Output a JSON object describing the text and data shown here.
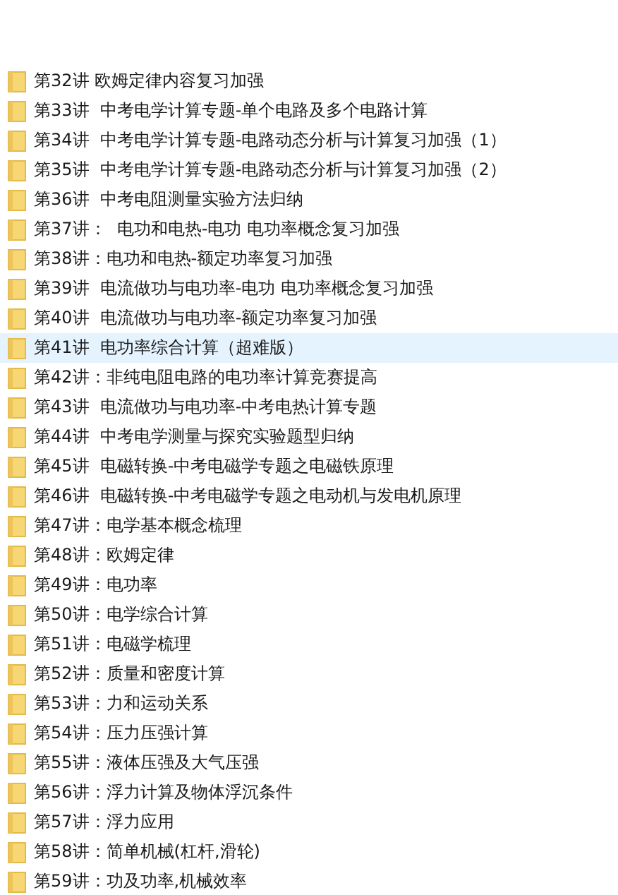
{
  "items": [
    {
      "name": "第32讲 欧姆定律内容复习加强",
      "selected": false
    },
    {
      "name": "第33讲  中考电学计算专题-单个电路及多个电路计算",
      "selected": false
    },
    {
      "name": "第34讲  中考电学计算专题-电路动态分析与计算复习加强（1）",
      "selected": false
    },
    {
      "name": "第35讲  中考电学计算专题-电路动态分析与计算复习加强（2）",
      "selected": false
    },
    {
      "name": "第36讲  中考电阻测量实验方法归纳",
      "selected": false
    },
    {
      "name": "第37讲：  电功和电热-电功 电功率概念复习加强",
      "selected": false
    },
    {
      "name": "第38讲：电功和电热-额定功率复习加强",
      "selected": false
    },
    {
      "name": "第39讲  电流做功与电功率-电功 电功率概念复习加强",
      "selected": false
    },
    {
      "name": "第40讲  电流做功与电功率-额定功率复习加强",
      "selected": false
    },
    {
      "name": "第41讲  电功率综合计算（超难版）",
      "selected": true
    },
    {
      "name": "第42讲：非纯电阻电路的电功率计算竞赛提高",
      "selected": false
    },
    {
      "name": "第43讲  电流做功与电功率-中考电热计算专题",
      "selected": false
    },
    {
      "name": "第44讲  中考电学测量与探究实验题型归纳",
      "selected": false
    },
    {
      "name": "第45讲  电磁转换-中考电磁学专题之电磁铁原理",
      "selected": false
    },
    {
      "name": "第46讲  电磁转换-中考电磁学专题之电动机与发电机原理",
      "selected": false
    },
    {
      "name": "第47讲：电学基本概念梳理",
      "selected": false
    },
    {
      "name": "第48讲：欧姆定律",
      "selected": false
    },
    {
      "name": "第49讲：电功率",
      "selected": false
    },
    {
      "name": "第50讲：电学综合计算",
      "selected": false
    },
    {
      "name": "第51讲：电磁学梳理",
      "selected": false
    },
    {
      "name": "第52讲：质量和密度计算",
      "selected": false
    },
    {
      "name": "第53讲：力和运动关系",
      "selected": false
    },
    {
      "name": "第54讲：压力压强计算",
      "selected": false
    },
    {
      "name": "第55讲：液体压强及大气压强",
      "selected": false
    },
    {
      "name": "第56讲：浮力计算及物体浮沉条件",
      "selected": false
    },
    {
      "name": "第57讲：浮力应用",
      "selected": false
    },
    {
      "name": "第58讲：简单机械(杠杆,滑轮)",
      "selected": false
    },
    {
      "name": "第59讲：功及功率,机械效率",
      "selected": false
    }
  ]
}
